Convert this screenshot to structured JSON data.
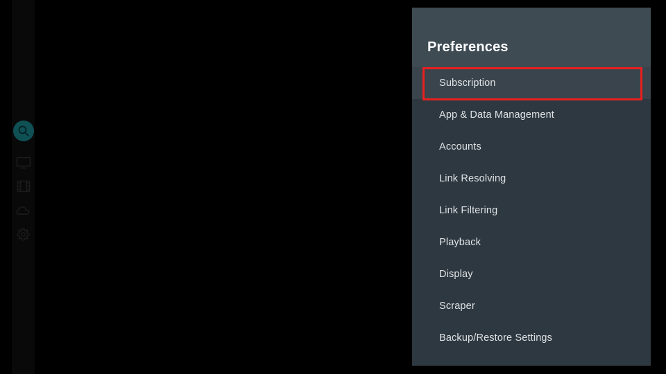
{
  "app": {
    "background_color": "#000000",
    "panel_background": "#2e3840",
    "panel_header_background": "#3e4b53",
    "accent_highlight_color": "#e8201f",
    "selected_row_background": "#3a444c",
    "nav_active_color": "#0f5055",
    "text_color": "#dfe3e6"
  },
  "nav_rail": {
    "items": [
      {
        "id": "search",
        "icon": "search-icon",
        "label": "Search",
        "active": true
      },
      {
        "id": "tv",
        "icon": "tv-icon",
        "label": "TV",
        "active": false
      },
      {
        "id": "movies",
        "icon": "film-strip-icon",
        "label": "Movies",
        "active": false
      },
      {
        "id": "cloud",
        "icon": "cloud-icon",
        "label": "Cloud",
        "active": false
      },
      {
        "id": "settings",
        "icon": "gear-icon",
        "label": "Settings",
        "active": false
      }
    ]
  },
  "preferences": {
    "title": "Preferences",
    "selected_item": "Subscription",
    "items": [
      {
        "label": "Subscription",
        "selected": true
      },
      {
        "label": "App & Data Management",
        "selected": false
      },
      {
        "label": "Accounts",
        "selected": false
      },
      {
        "label": "Link Resolving",
        "selected": false
      },
      {
        "label": "Link Filtering",
        "selected": false
      },
      {
        "label": "Playback",
        "selected": false
      },
      {
        "label": "Display",
        "selected": false
      },
      {
        "label": "Scraper",
        "selected": false
      },
      {
        "label": "Backup/Restore Settings",
        "selected": false
      }
    ]
  },
  "annotation": {
    "type": "highlight-rectangle",
    "target": "Subscription",
    "color": "#e8201f"
  }
}
